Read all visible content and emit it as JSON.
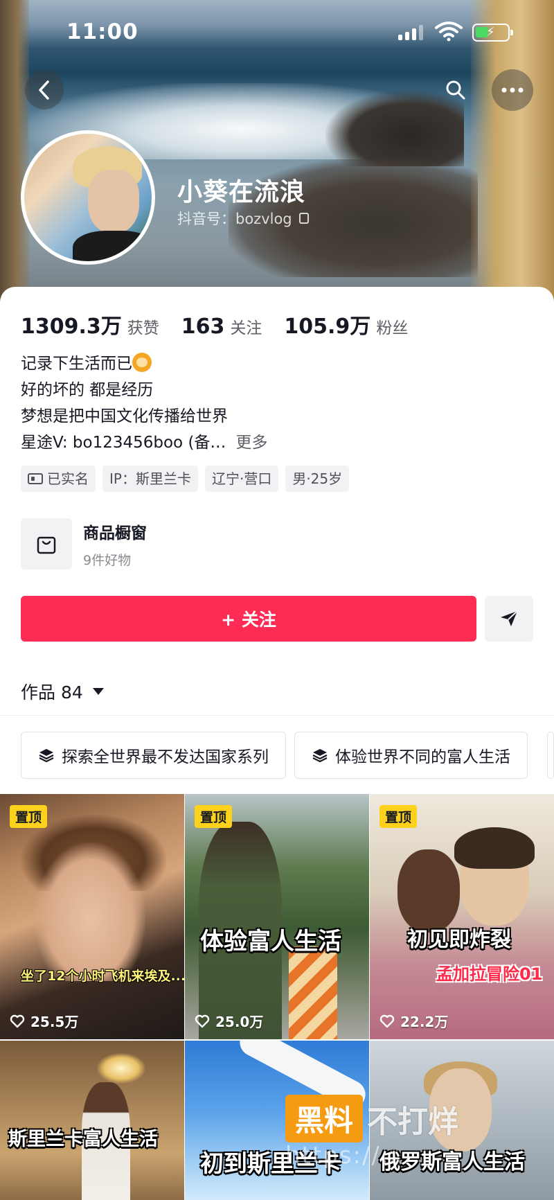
{
  "status": {
    "time": "11:00"
  },
  "profile": {
    "nickname": "小葵在流浪",
    "douyin_id": "抖音号：bozvlog",
    "stats": [
      {
        "value": "1309.3万",
        "label": "获赞"
      },
      {
        "value": "163",
        "label": "关注"
      },
      {
        "value": "105.9万",
        "label": "粉丝"
      }
    ],
    "bio": [
      "记录下生活而已",
      "好的坏的 都是经历",
      "梦想是把中国文化传播给世界",
      "星途V: bo123456boo (备…"
    ],
    "bio_more": "更多",
    "tags": [
      "已实名",
      "IP：斯里兰卡",
      "辽宁·营口",
      "男·25岁"
    ]
  },
  "shop": {
    "title": "商品橱窗",
    "subtitle": "9件好物"
  },
  "actions": {
    "follow_label": "+ 关注"
  },
  "works": {
    "label": "作品 84"
  },
  "collections": [
    "探索全世界最不发达国家系列",
    "体验世界不同的富人生活"
  ],
  "videos": [
    {
      "pinned": "置顶",
      "caption": "坐了12个小时飞机来埃及...",
      "likes": "25.5万"
    },
    {
      "pinned": "置顶",
      "caption": "体验富人生活",
      "likes": "25.0万"
    },
    {
      "pinned": "置顶",
      "caption": "初见即炸裂",
      "caption2": "孟加拉冒险01",
      "likes": "22.2万"
    },
    {
      "caption": "斯里兰卡富人生活"
    },
    {
      "caption": "初到斯里兰卡"
    },
    {
      "caption": "俄罗斯富人生活"
    }
  ],
  "watermark": {
    "badge": "黑料",
    "text": "不打烊",
    "url": "https://…"
  },
  "icons": [
    "back-icon",
    "search-icon",
    "more-icon",
    "copy-icon",
    "id-card-icon",
    "shopping-bag-icon",
    "share-icon",
    "stack-icon",
    "heart-icon"
  ],
  "colors": {
    "accent": "#fe2c55",
    "pin": "#fcd21c"
  }
}
